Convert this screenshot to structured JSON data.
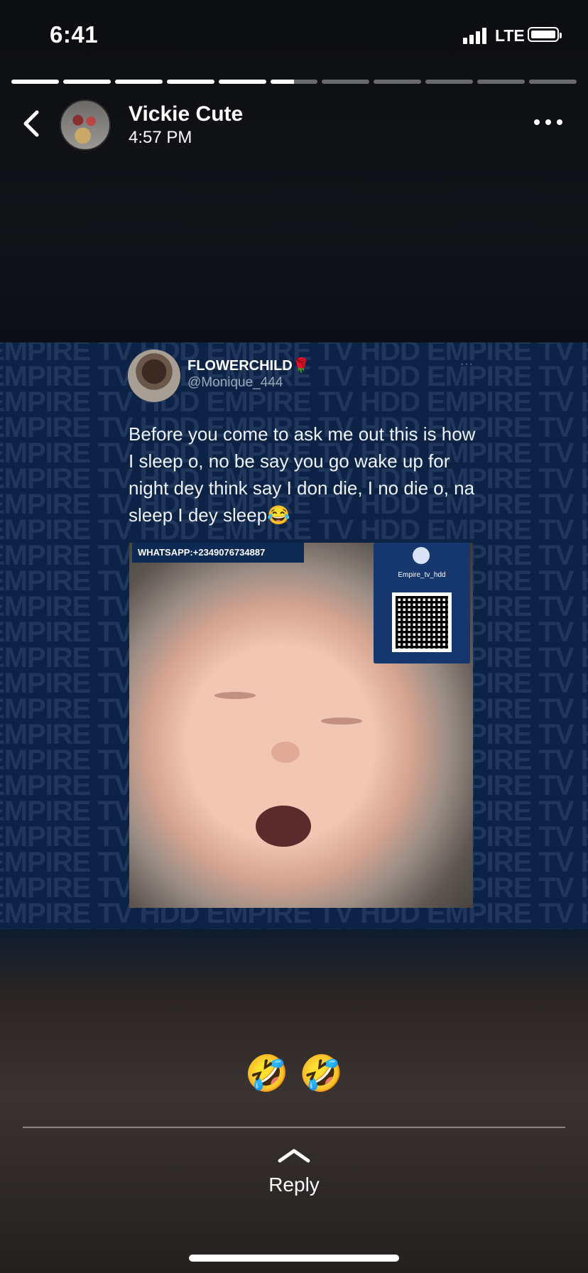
{
  "status_bar": {
    "time": "6:41",
    "network": "LTE",
    "battery_level": 1.0
  },
  "progress": {
    "total_segments": 11,
    "segment_fill": [
      1,
      1,
      1,
      1,
      1,
      0.5,
      0,
      0,
      0,
      0,
      0
    ]
  },
  "header": {
    "name": "Vickie Cute",
    "time": "4:57 PM"
  },
  "tweet": {
    "display_name": "FLOWERCHILD",
    "emoji": "🌹",
    "handle": "@Monique_444",
    "more": "···",
    "text": "Before you come to ask me out  this is how I sleep o, no be say you go wake up for night dey think say  I don die, I no die o, na sleep I dey sleep😂",
    "whatsapp_banner": "WHATSAPP:+2349076734887",
    "qr_label": "Empire_tv_hdd",
    "watermark": "EMPIRE TV HDD"
  },
  "caption": "🤣 🤣",
  "reply": {
    "label": "Reply"
  }
}
